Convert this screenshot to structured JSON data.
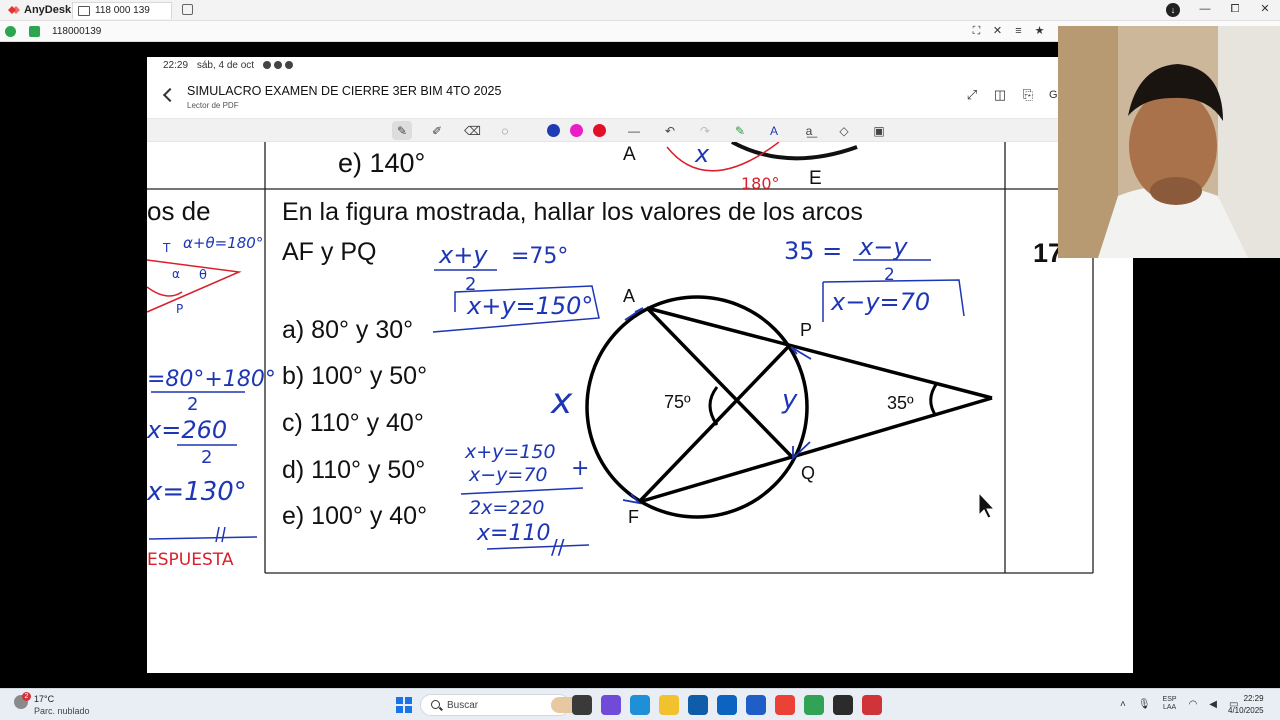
{
  "anydesk": {
    "app_name": "AnyDesk",
    "tab_label": "118 000 139",
    "address": "118000139",
    "window_controls": [
      "—",
      "⧠",
      "✕"
    ]
  },
  "tablet": {
    "time": "22:29",
    "date": "sáb, 4 de oct"
  },
  "reader": {
    "title": "SIMULACRO EXAMEN DE CIERRE 3ER BIM 4TO 2025",
    "subtitle": "Lector de PDF",
    "g_label": "G"
  },
  "pen_colors": [
    "#1f3bb3",
    "#e91ec5",
    "#e3102a"
  ],
  "worksheet": {
    "prev_option": "e) 140°",
    "prev_fig_label_a": "A",
    "prev_fig_label_e": "E",
    "prev_x": "x",
    "prev_180": "180°",
    "left_text": "os  de",
    "left_notes": {
      "sum": "α+θ=180°",
      "t": "T",
      "a": "α",
      "theta": "θ",
      "p": "P",
      "frac_num": "=80°+180°",
      "frac_den": "2",
      "x260_num": "x=260",
      "x260_den": "2",
      "x130": "x=130°",
      "answer": "ESPUESTA"
    },
    "problem_line1": "En la figura mostrada, hallar los valores de los arcos",
    "problem_line2": "AF y PQ",
    "options": [
      "a) 80° y 30°",
      "b) 100° y 50°",
      "c) 110° y 40°",
      "d) 110° y 50°",
      "e) 100° y 40°"
    ],
    "figure": {
      "label_a": "A",
      "label_p": "P",
      "label_q": "Q",
      "label_f": "F",
      "angle_inside": "75º",
      "angle_outside": "35º"
    },
    "notes": {
      "eq1_num": "x+y",
      "eq1_rhs": "=75°",
      "eq1_den": "2",
      "eq1_boxed": "x+y=150°",
      "eq2_lhs": "35 =",
      "eq2_num": "x−y",
      "eq2_den": "2",
      "eq2_boxed": "x−y=70",
      "var_x": "x",
      "var_y": "y",
      "sys1": "x+y=150",
      "sys2": "x−y=70",
      "sys_plus": "+",
      "sys3": "2x=220",
      "sys4": "x=110",
      "sys_mark": "//"
    },
    "page_number": "17"
  },
  "taskbar": {
    "weather_temp": "17°C",
    "weather_desc": "Parc. nublado",
    "weather_badge": "2",
    "search_placeholder": "Buscar",
    "lang_top": "ESP",
    "lang_bottom": "LAA",
    "time": "22:29",
    "date": "4/10/2025",
    "app_colors": [
      "#3a3a3a",
      "#6f4bd8",
      "#1f8fd8",
      "#f2c12e",
      "#0f5cab",
      "#0c64c0",
      "#1e5ec6",
      "#ea4335",
      "#31a354",
      "#2b2b2b",
      "#d13438"
    ]
  }
}
